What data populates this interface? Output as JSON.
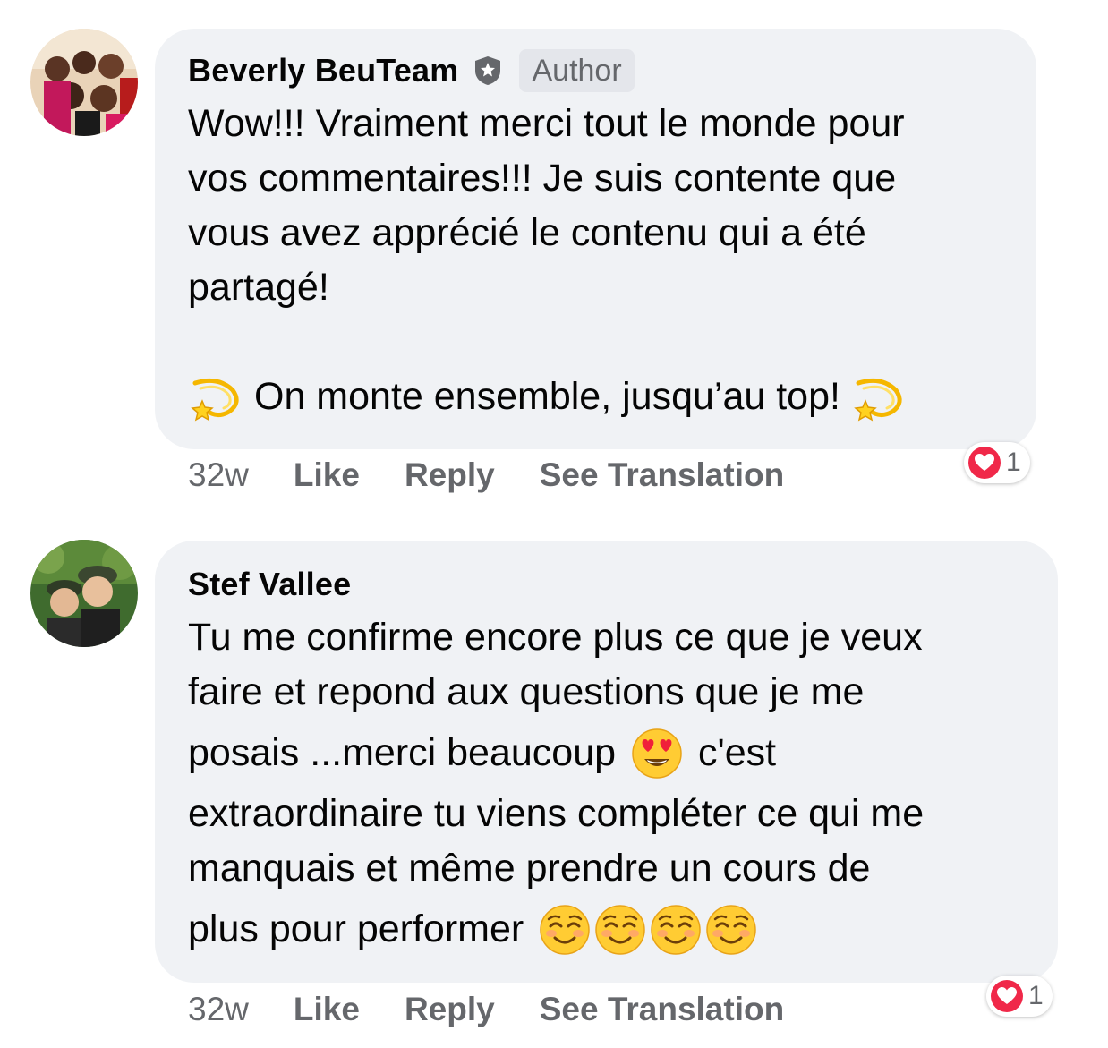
{
  "comments": [
    {
      "author": "Beverly BeuTeam",
      "badge": "Author",
      "lines": [
        "Wow!!! Vraiment merci tout le monde pour",
        "vos commentaires!!! Je suis contente que",
        "vous avez apprécié le contenu qui a été",
        "partagé!"
      ],
      "closing": "On monte ensemble, jusqu’au top!",
      "closing_emoji": "dizzy-star-emoji",
      "time": "32w",
      "like": "Like",
      "reply": "Reply",
      "translate": "See Translation",
      "reaction_count": "1",
      "reaction_icon": "heart-icon",
      "reaction_color": "#f02849"
    },
    {
      "author": "Stef Vallee",
      "lines": [
        "Tu me confirme encore plus ce que je veux",
        "faire et repond aux questions que je me"
      ],
      "line3_pre": "posais ...merci beaucoup",
      "line3_post": "c'est",
      "line3_emoji": "heart-eyes-emoji",
      "lines_b": [
        "extraordinaire tu viens compléter ce qui me",
        "manquais et même prendre un cours de"
      ],
      "line_last": "plus pour performer",
      "last_emojis": [
        "smiling-blush-emoji",
        "smiling-blush-emoji",
        "smiling-blush-emoji",
        "smiling-blush-emoji"
      ],
      "time": "32w",
      "like": "Like",
      "reply": "Reply",
      "translate": "See Translation",
      "reaction_count": "1",
      "reaction_icon": "heart-icon",
      "reaction_color": "#f02849"
    }
  ],
  "colors": {
    "bubble": "#f0f2f5",
    "secondary_text": "#65676b",
    "badge_bg": "#e4e6eb"
  }
}
